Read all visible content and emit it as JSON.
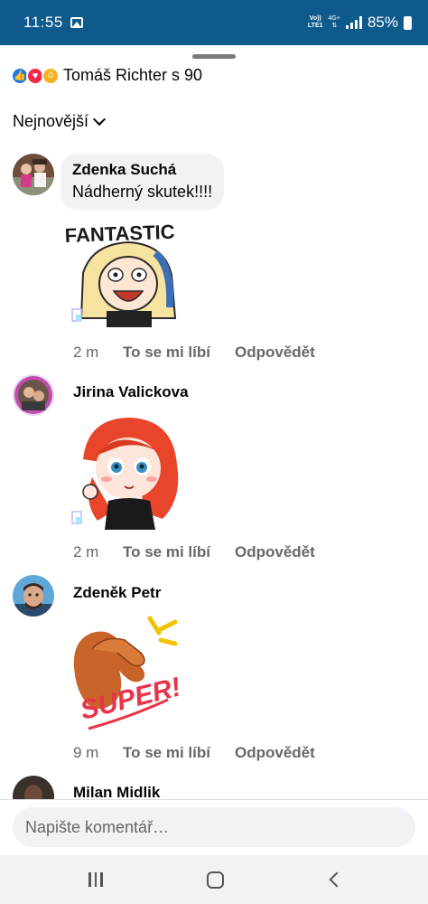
{
  "status_bar": {
    "time": "11:55",
    "volte_top": "Vo))",
    "volte_bottom": "LTE1",
    "network": "4G+",
    "battery": "85%"
  },
  "reactions": {
    "summary": "Tomáš Richter s 90",
    "icons": [
      "like-icon",
      "love-icon",
      "care-icon"
    ]
  },
  "sort": {
    "label": "Nejnovější"
  },
  "comments": [
    {
      "author": "Zdenka Suchá",
      "text": "Nádherný skutek!!!!",
      "sticker_caption": "FANTASTIC",
      "time": "2 m",
      "like_label": "To se mi líbí",
      "reply_label": "Odpovědět"
    },
    {
      "author": "Jirina Valickova",
      "time": "2 m",
      "like_label": "To se mi líbí",
      "reply_label": "Odpovědět"
    },
    {
      "author": "Zdeněk Petr",
      "sticker_caption": "SUPER!",
      "time": "9 m",
      "like_label": "To se mi líbí",
      "reply_label": "Odpovědět"
    },
    {
      "author": "Milan Midlik"
    }
  ],
  "comment_input": {
    "placeholder": "Napište komentář…"
  },
  "colors": {
    "status_bar": "#0f5a8c",
    "bubble": "#f0f2f5",
    "meta_text": "#65676b",
    "like": "#1877f2",
    "love": "#f02849",
    "care": "#f7b125"
  }
}
